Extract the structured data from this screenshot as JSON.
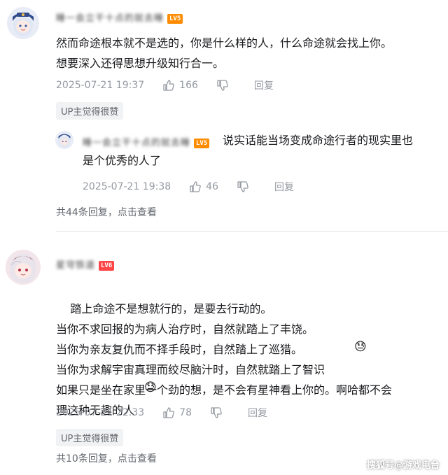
{
  "comments": [
    {
      "username": "睡一会立干十点的就去睡",
      "level": "LV5",
      "text": "然而命途根本就不是选的，你是什么样的人，什么命途就会找上你。\n想要深入还得思想升级知行合一。",
      "time": "2025-07-21 19:37",
      "likes": "166",
      "reply_label": "回复",
      "tag": "UP主觉得很赞",
      "sub_reply": {
        "username": "睡一会立干十点的就去睡",
        "level": "LV5",
        "text": "说实话能当场变成命途行者的现实里也\n是个优秀的人了",
        "time": "2025-07-21 19:38",
        "likes": "46",
        "reply_label": "回复"
      },
      "more": "共44条回复，点击查看"
    },
    {
      "username": "星穹铁道",
      "level": "LV6",
      "text": "踏上命途不是想就行的，是要去行动的。\n当你不求回报的为病人治疗时，自然就踏上了丰饶。\n当你为亲友复仇而不择手段时，自然踏上了巡猎。\n当你为求解宇宙真理而绞尽脑汁时，自然就踏上了智识\n如果只是坐在家里一个劲的想，是不会有星神看上你的。啊哈都不会\n理这种无趣的人",
      "time": "2025-07-21 22:33",
      "likes": "78",
      "reply_label": "回复",
      "tag": "UP主觉得很赞",
      "more": "共10条回复，点击查看"
    }
  ],
  "watermark": "搜狐号@游戏电台",
  "colors": {
    "text": "#18191c",
    "meta": "#9499a0",
    "lv5": "#ff8c00",
    "lv6": "#ff4545",
    "tag_bg": "#f1f2f3"
  }
}
